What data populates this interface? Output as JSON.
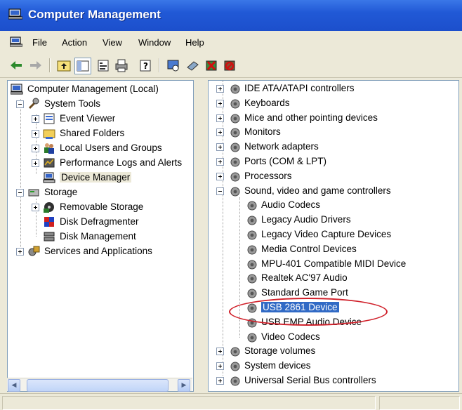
{
  "window": {
    "title": "Computer Management"
  },
  "menu": [
    "File",
    "Action",
    "View",
    "Window",
    "Help"
  ],
  "left_tree": [
    {
      "label": "Computer Management (Local)",
      "icon": "computer-icon"
    },
    {
      "label": "System Tools",
      "icon": "tools-icon"
    },
    {
      "label": "Event Viewer",
      "icon": "event-viewer-icon"
    },
    {
      "label": "Shared Folders",
      "icon": "shared-folder-icon"
    },
    {
      "label": "Local Users and Groups",
      "icon": "users-icon"
    },
    {
      "label": "Performance Logs and Alerts",
      "icon": "performance-icon"
    },
    {
      "label": "Device Manager",
      "icon": "device-manager-icon",
      "selected": true
    },
    {
      "label": "Storage",
      "icon": "storage-icon"
    },
    {
      "label": "Removable Storage",
      "icon": "removable-storage-icon"
    },
    {
      "label": "Disk Defragmenter",
      "icon": "defrag-icon"
    },
    {
      "label": "Disk Management",
      "icon": "disk-management-icon"
    },
    {
      "label": "Services and Applications",
      "icon": "services-icon"
    }
  ],
  "right_tree": [
    {
      "label": "IDE ATA/ATAPI controllers",
      "icon": "ide-controller-icon"
    },
    {
      "label": "Keyboards",
      "icon": "keyboard-icon"
    },
    {
      "label": "Mice and other pointing devices",
      "icon": "mouse-icon"
    },
    {
      "label": "Monitors",
      "icon": "monitor-icon"
    },
    {
      "label": "Network adapters",
      "icon": "network-adapter-icon"
    },
    {
      "label": "Ports (COM & LPT)",
      "icon": "port-icon"
    },
    {
      "label": "Processors",
      "icon": "processor-icon"
    },
    {
      "label": "Sound, video and game controllers",
      "icon": "sound-icon"
    },
    {
      "label": "Audio Codecs",
      "icon": "sound-device-icon"
    },
    {
      "label": "Legacy Audio Drivers",
      "icon": "sound-device-icon"
    },
    {
      "label": "Legacy Video Capture Devices",
      "icon": "sound-device-icon"
    },
    {
      "label": "Media Control Devices",
      "icon": "sound-device-icon"
    },
    {
      "label": "MPU-401 Compatible MIDI Device",
      "icon": "sound-device-icon"
    },
    {
      "label": "Realtek AC'97 Audio",
      "icon": "sound-device-icon"
    },
    {
      "label": "Standard Game Port",
      "icon": "sound-device-icon"
    },
    {
      "label": "USB 2861 Device",
      "icon": "sound-device-icon",
      "selected": true
    },
    {
      "label": "USB EMP Audio Device",
      "icon": "sound-device-icon"
    },
    {
      "label": "Video Codecs",
      "icon": "sound-device-icon"
    },
    {
      "label": "Storage volumes",
      "icon": "storage-volume-icon"
    },
    {
      "label": "System devices",
      "icon": "system-device-icon"
    },
    {
      "label": "Universal Serial Bus controllers",
      "icon": "usb-icon"
    }
  ],
  "colors": {
    "title_bar": "#2159d6",
    "selection": "#316ac5",
    "annotation": "#d0202a"
  }
}
